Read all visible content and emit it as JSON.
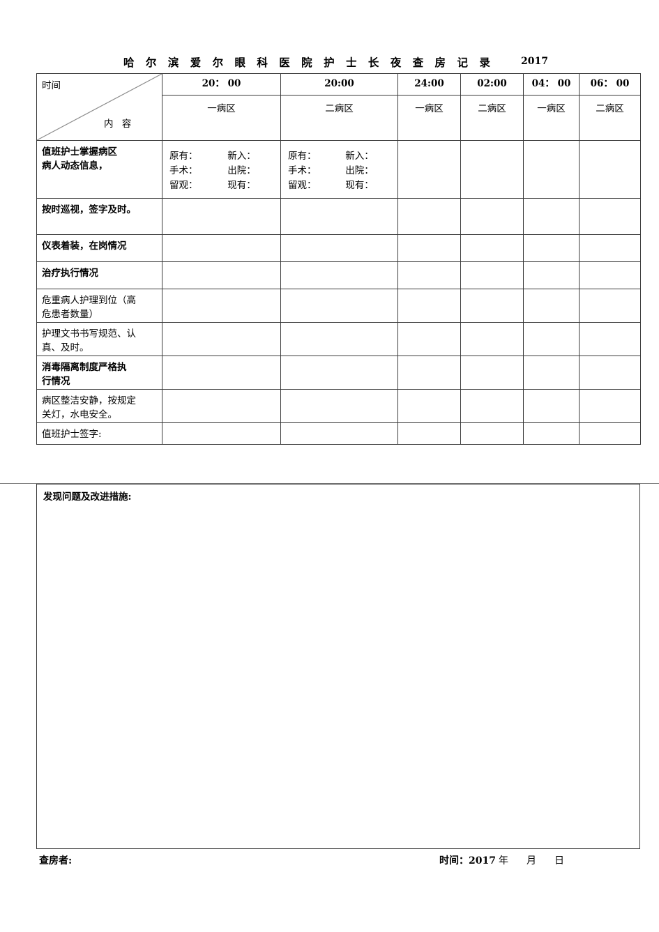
{
  "document": {
    "title": "哈 尔 滨 爱 尔 眼 科 医 院 护 士 长 夜 查 房 记 录",
    "year": "2017"
  },
  "corner_cell": {
    "row_header": "时间",
    "col_header": "内 容"
  },
  "table": {
    "columns": [
      {
        "time": "20： 00",
        "ward": "一病区"
      },
      {
        "time": "20:00",
        "ward": "二病区"
      },
      {
        "time": "24:00",
        "ward": "一病区"
      },
      {
        "time": "02:00",
        "ward": "二病区"
      },
      {
        "time": "04： 00",
        "ward": "一病区"
      },
      {
        "time": "06： 00",
        "ward": "二病区"
      }
    ],
    "rows": [
      {
        "label": "值班护士掌握病区\n病人动态信息，",
        "bold": true,
        "type": "stats"
      },
      {
        "label": "按时巡视，签字及时。",
        "bold": true,
        "type": "plain"
      },
      {
        "label": "仪表着装，在岗情况",
        "bold": true,
        "type": "plain"
      },
      {
        "label": "治疗执行情况",
        "bold": true,
        "type": "plain"
      },
      {
        "label": "危重病人护理到位（高\n危患者数量）",
        "bold": false,
        "type": "plain"
      },
      {
        "label": "护理文书书写规范、认\n真、及时。",
        "bold": false,
        "type": "plain"
      },
      {
        "label": "消毒隔离制度严格执\n行情况",
        "bold": true,
        "type": "plain"
      },
      {
        "label": "病区整洁安静，按规定\n关灯，水电安全。",
        "bold": false,
        "type": "plain"
      },
      {
        "label": "值班护士签字:",
        "bold": false,
        "type": "plain"
      }
    ],
    "patient_stats": {
      "field1": "原有：",
      "field2": "新入：",
      "field3": "手术：",
      "field4": "出院：",
      "field5": "留观：",
      "field6": "现有："
    }
  },
  "notes": {
    "label": "发现问题及改进措施:"
  },
  "footer": {
    "inspector_label": "查房者:",
    "time_label": "时间：",
    "year": "2017",
    "year_unit": "年",
    "month_unit": "月",
    "day_unit": "日"
  }
}
